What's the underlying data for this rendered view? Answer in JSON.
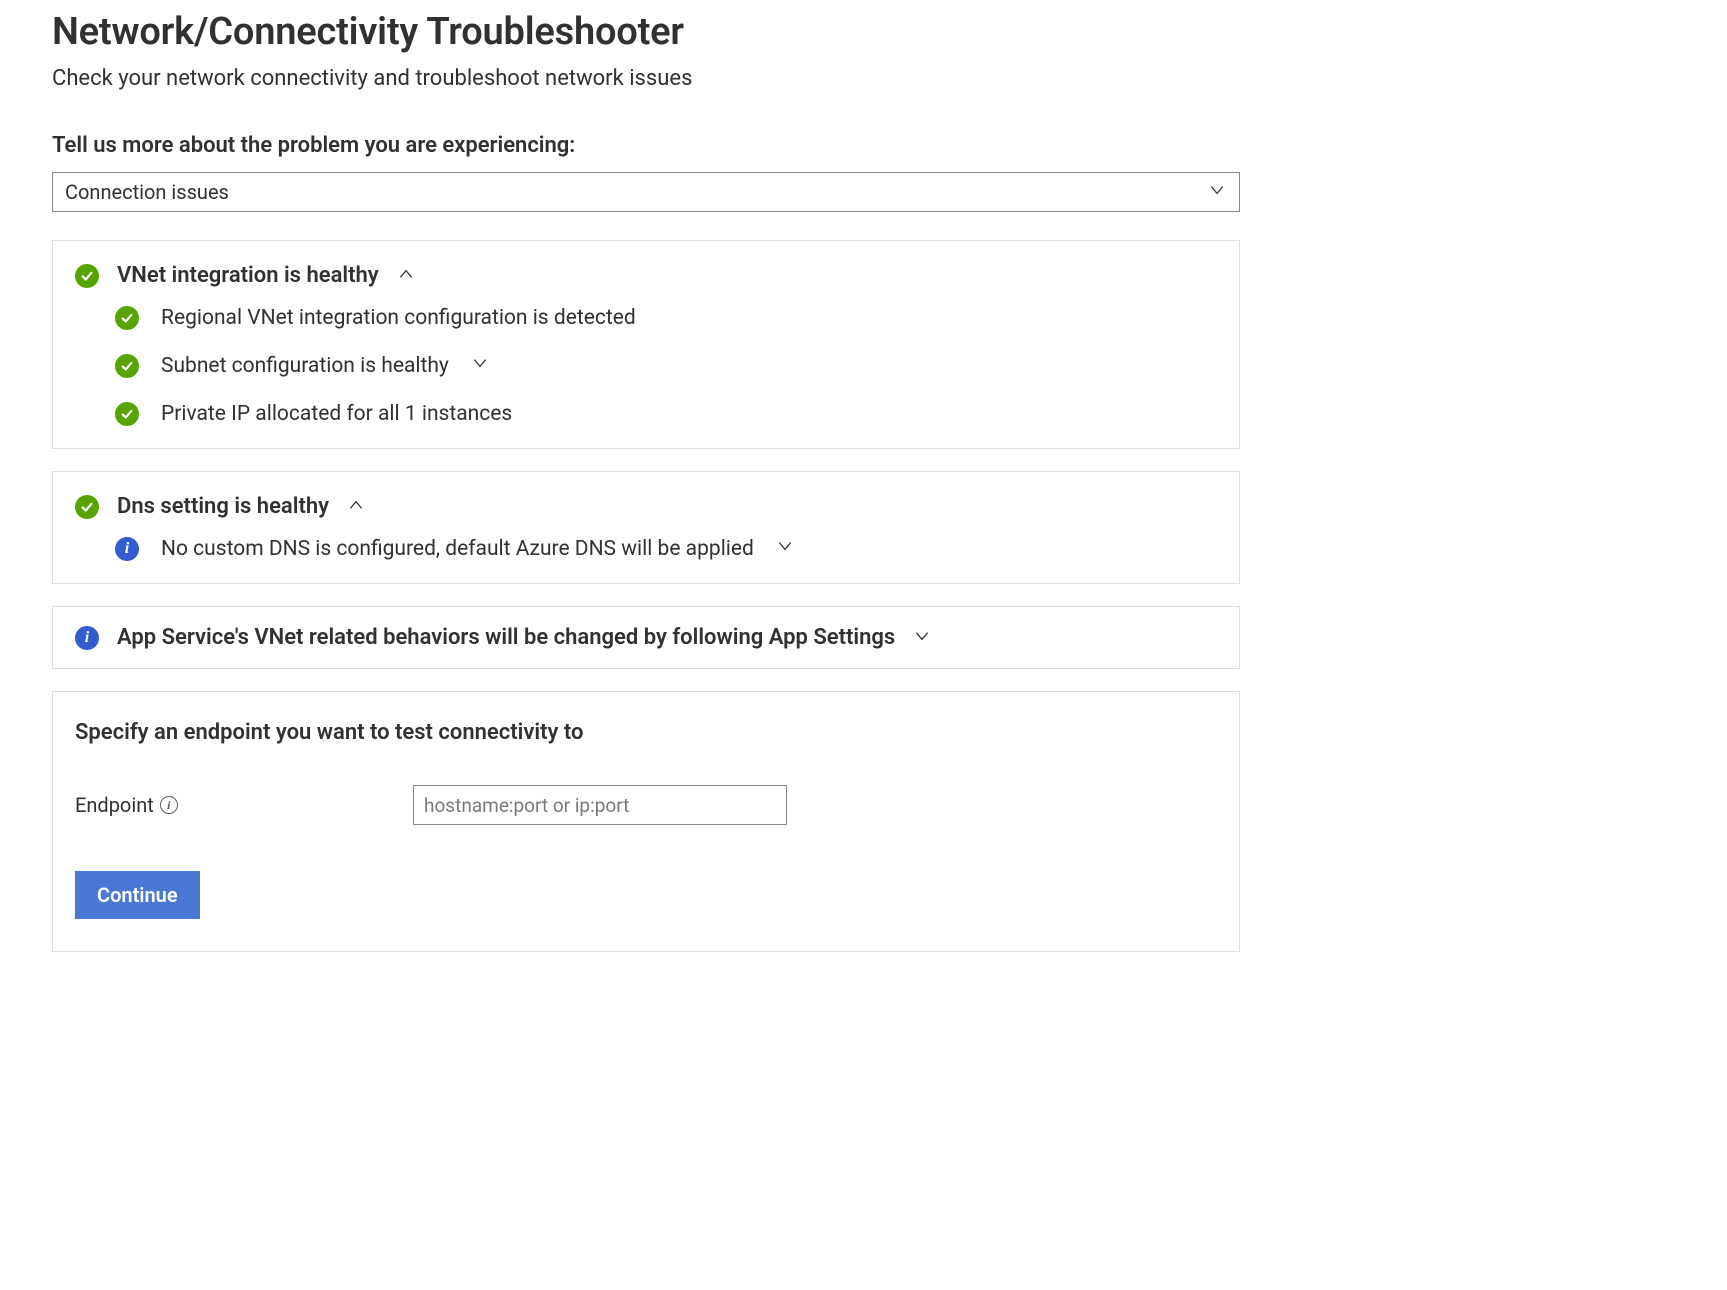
{
  "header": {
    "title": "Network/Connectivity Troubleshooter",
    "subtitle": "Check your network connectivity and troubleshoot network issues"
  },
  "prompt": {
    "label": "Tell us more about the problem you are experiencing:",
    "selected": "Connection issues"
  },
  "panels": {
    "vnet": {
      "title": "VNet integration is healthy",
      "items": [
        {
          "text": "Regional VNet integration configuration is detected"
        },
        {
          "text": "Subnet configuration is healthy"
        },
        {
          "text": "Private IP allocated for all 1 instances"
        }
      ]
    },
    "dns": {
      "title": "Dns setting is healthy",
      "items": [
        {
          "text": "No custom DNS is configured, default Azure DNS will be applied"
        }
      ]
    },
    "appSettings": {
      "title": "App Service's VNet related behaviors will be changed by following App Settings"
    }
  },
  "endpoint": {
    "title": "Specify an endpoint you want to test connectivity to",
    "label": "Endpoint",
    "placeholder": "hostname:port or ip:port",
    "button": "Continue"
  },
  "colors": {
    "successGreen": "#57a300",
    "infoBlue": "#335ccc",
    "primaryButton": "#4a78d4"
  }
}
